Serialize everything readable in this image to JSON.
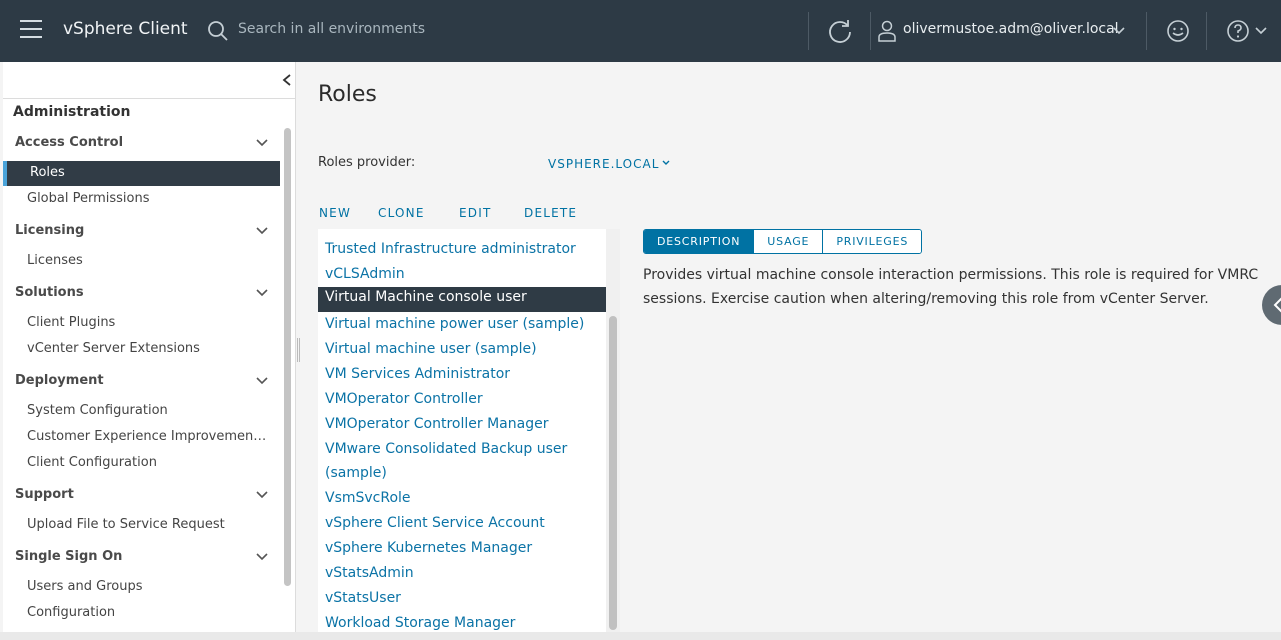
{
  "header": {
    "app_title": "vSphere Client",
    "search_placeholder": "Search in all environments",
    "user": "olivermustoe.adm@oliver.local"
  },
  "nav": {
    "title": "Administration",
    "sections": [
      {
        "label": "Access Control",
        "items": [
          "Roles",
          "Global Permissions"
        ]
      },
      {
        "label": "Licensing",
        "items": [
          "Licenses"
        ]
      },
      {
        "label": "Solutions",
        "items": [
          "Client Plugins",
          "vCenter Server Extensions"
        ]
      },
      {
        "label": "Deployment",
        "items": [
          "System Configuration",
          "Customer Experience Improvement P...",
          "Client Configuration"
        ]
      },
      {
        "label": "Support",
        "items": [
          "Upload File to Service Request"
        ]
      },
      {
        "label": "Single Sign On",
        "items": [
          "Users and Groups",
          "Configuration"
        ]
      }
    ],
    "active_item": "Roles"
  },
  "main": {
    "title": "Roles",
    "provider_label": "Roles provider:",
    "provider_value": "VSPHERE.LOCAL",
    "actions": [
      "NEW",
      "CLONE",
      "EDIT",
      "DELETE"
    ],
    "roles": [
      "Trusted Infrastructure administrator",
      "vCLSAdmin",
      "Virtual Machine console user",
      "Virtual machine power user (sample)",
      "Virtual machine user (sample)",
      "VM Services Administrator",
      "VMOperator Controller",
      "VMOperator Controller Manager",
      "VMware Consolidated Backup user (sample)",
      "VsmSvcRole",
      "vSphere Client Service Account",
      "vSphere Kubernetes Manager",
      "vStatsAdmin",
      "vStatsUser",
      "Workload Storage Manager"
    ],
    "selected_role": "Virtual Machine console user",
    "tabs": [
      "DESCRIPTION",
      "USAGE",
      "PRIVILEGES"
    ],
    "active_tab": "DESCRIPTION",
    "description": "Provides virtual machine console interaction permissions. This role is required for VMRC sessions. Exercise caution when altering/removing this role from vCenter Server."
  },
  "colors": {
    "header_bg": "#2d3a45",
    "accent": "#0072a3",
    "selected_bg": "#2f3b45"
  }
}
